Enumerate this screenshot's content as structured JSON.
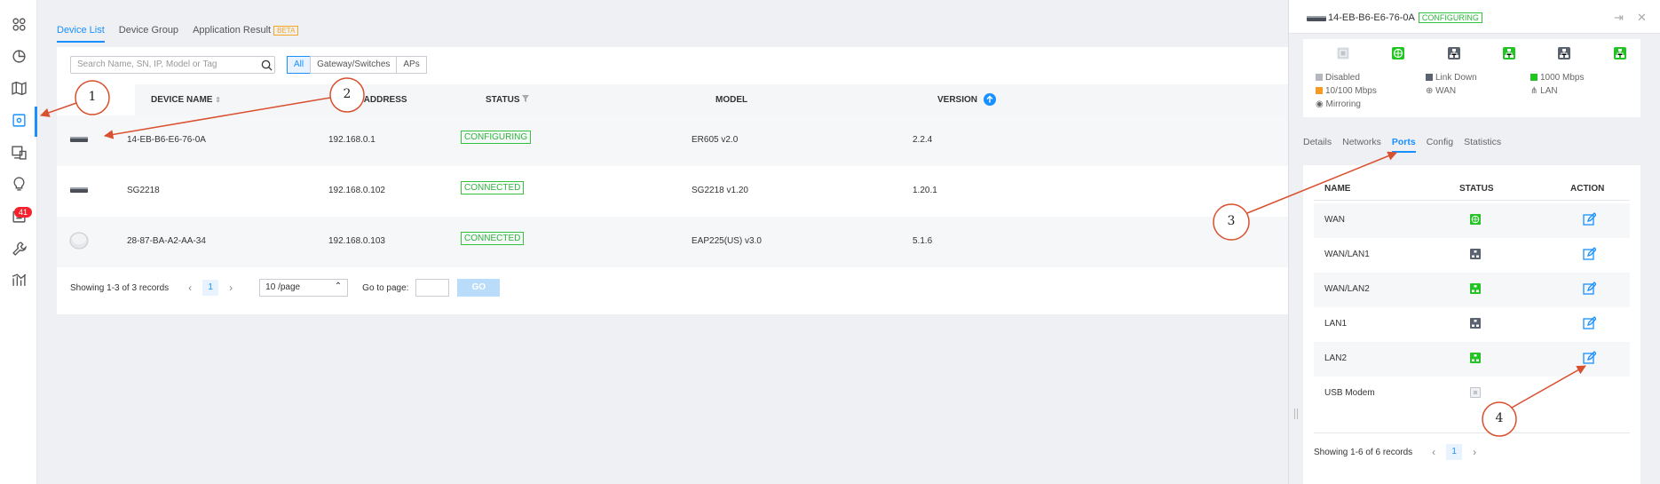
{
  "sidebar": {
    "icons": [
      "dashboard-icon",
      "statistics-icon",
      "map-icon",
      "devices-icon",
      "clients-icon",
      "insights-icon",
      "log-icon",
      "tools-icon",
      "reports-icon"
    ],
    "badge": "41"
  },
  "top_tabs": [
    {
      "label": "Device List"
    },
    {
      "label": "Device Group"
    },
    {
      "label": "Application Result"
    }
  ],
  "beta_label": "BETA",
  "search": {
    "placeholder": "Search Name, SN, IP, Model or Tag"
  },
  "filters": [
    {
      "label": "All"
    },
    {
      "label": "Gateway/Switches"
    },
    {
      "label": "APs"
    }
  ],
  "table": {
    "columns": [
      "DEVICE NAME",
      "IP ADDRESS",
      "STATUS",
      "MODEL",
      "VERSION"
    ],
    "rows": [
      {
        "icon": "gateway-device-icon",
        "name": "14-EB-B6-E6-76-0A",
        "ip": "192.168.0.1",
        "status": "CONFIGURING",
        "model": "ER605 v2.0",
        "version": "2.2.4"
      },
      {
        "icon": "switch-device-icon",
        "name": "SG2218",
        "ip": "192.168.0.102",
        "status": "CONNECTED",
        "model": "SG2218 v1.20",
        "version": "1.20.1"
      },
      {
        "icon": "ap-device-icon",
        "name": "28-87-BA-A2-AA-34",
        "ip": "192.168.0.103",
        "status": "CONNECTED",
        "model": "EAP225(US) v3.0",
        "version": "5.1.6"
      }
    ]
  },
  "pager": {
    "summary": "Showing 1-3 of 3 records",
    "page": "1",
    "page_size": "10 /page",
    "goto_label": "Go to page:",
    "go_label": "GO"
  },
  "panel": {
    "device_name": "14-EB-B6-E6-76-0A",
    "status": "CONFIGURING",
    "legend": {
      "disabled": "Disabled",
      "link_down": "Link Down",
      "gbps": "1000 Mbps",
      "mbps": "10/100 Mbps",
      "wan": "WAN",
      "lan": "LAN",
      "mirroring": "Mirroring"
    },
    "tabs": [
      {
        "label": "Details"
      },
      {
        "label": "Networks"
      },
      {
        "label": "Ports"
      },
      {
        "label": "Config"
      },
      {
        "label": "Statistics"
      }
    ],
    "port_columns": [
      "NAME",
      "STATUS",
      "ACTION"
    ],
    "ports": [
      {
        "name": "WAN",
        "status": "wan-1000",
        "editable": true
      },
      {
        "name": "WAN/LAN1",
        "status": "link-down",
        "editable": true
      },
      {
        "name": "WAN/LAN2",
        "status": "lan-1000",
        "editable": true
      },
      {
        "name": "LAN1",
        "status": "link-down",
        "editable": true
      },
      {
        "name": "LAN2",
        "status": "lan-1000",
        "editable": true
      },
      {
        "name": "USB Modem",
        "status": "disabled",
        "editable": false
      }
    ],
    "pager_summary": "Showing 1-6 of 6 records",
    "pager_page": "1"
  },
  "colors": {
    "accent": "#1890ff",
    "connected": "#2db53a",
    "link_down": "#5a6270",
    "gbps": "#22c322",
    "mbps": "#f59a23",
    "disabled": "#c0c4cc",
    "annotation": "#d9502f"
  },
  "annotations": [
    "1",
    "2",
    "3",
    "4"
  ]
}
